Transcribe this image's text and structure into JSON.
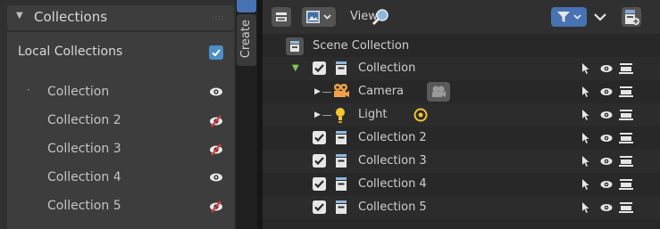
{
  "left_panel": {
    "title": "Collections",
    "local_collections_label": "Local Collections",
    "local_collections_checked": true,
    "items": [
      {
        "label": "Collection",
        "active": true,
        "visible": true
      },
      {
        "label": "Collection 2",
        "active": false,
        "visible": false
      },
      {
        "label": "Collection 3",
        "active": false,
        "visible": false
      },
      {
        "label": "Collection 4",
        "active": false,
        "visible": true
      },
      {
        "label": "Collection 5",
        "active": false,
        "visible": false
      }
    ]
  },
  "tabs": {
    "create_label": "Create"
  },
  "outliner": {
    "header": {
      "view_label": "View"
    },
    "scene_label": "Scene Collection",
    "rows": [
      {
        "label": "Collection",
        "kind": "collection",
        "expanded": true,
        "checked": true
      },
      {
        "label": "Camera",
        "kind": "camera"
      },
      {
        "label": "Light",
        "kind": "light"
      },
      {
        "label": "Collection 2",
        "kind": "collection",
        "checked": true
      },
      {
        "label": "Collection 3",
        "kind": "collection",
        "checked": true
      },
      {
        "label": "Collection 4",
        "kind": "collection",
        "checked": true
      },
      {
        "label": "Collection 5",
        "kind": "collection",
        "checked": true
      }
    ]
  },
  "colors": {
    "accent_blue": "#4772b3",
    "checkbox_blue": "#4c8ec8",
    "hidden_red": "#d43b3b",
    "expand_green": "#86c35b"
  }
}
